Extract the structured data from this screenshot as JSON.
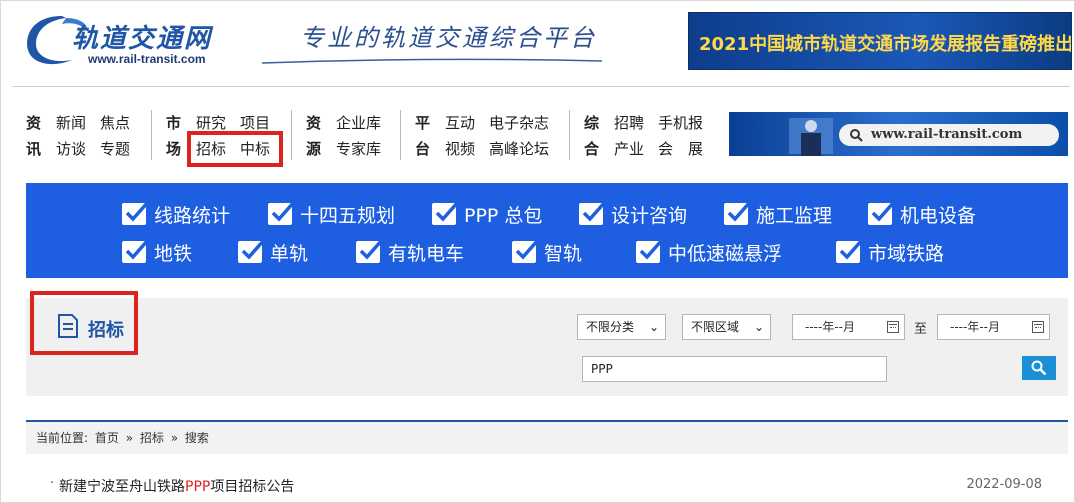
{
  "header": {
    "logo_cn": "轨道交通网",
    "logo_url": "www.rail-transit.com",
    "slogan": "专业的轨道交通综合平台",
    "banner_text": "2021中国城市轨道交通市场发展报告重磅推出"
  },
  "nav": {
    "groups": [
      {
        "head": [
          "资",
          "讯"
        ],
        "rows": [
          [
            "新闻",
            "焦点"
          ],
          [
            "访谈",
            "专题"
          ]
        ]
      },
      {
        "head": [
          "市",
          "场"
        ],
        "rows": [
          [
            "研究",
            "项目"
          ],
          [
            "招标",
            "中标"
          ]
        ]
      },
      {
        "head": [
          "资",
          "源"
        ],
        "rows": [
          [
            "企业库"
          ],
          [
            "专家库"
          ]
        ]
      },
      {
        "head": [
          "平",
          "台"
        ],
        "rows": [
          [
            "互动",
            "电子杂志"
          ],
          [
            "视频",
            "高峰论坛"
          ]
        ]
      },
      {
        "head": [
          "综",
          "合"
        ],
        "rows": [
          [
            "招聘",
            "手机报"
          ],
          [
            "产业",
            "会　展"
          ]
        ]
      }
    ],
    "banner_url": "www.rail-transit.com"
  },
  "categories": [
    "线路统计",
    "十四五规划",
    "PPP 总包",
    "设计咨询",
    "施工监理",
    "机电设备",
    "地铁",
    "单轨",
    "有轨电车",
    "智轨",
    "中低速磁悬浮",
    "市域铁路"
  ],
  "search": {
    "section_title": "招标",
    "category_select": "不限分类",
    "region_select": "不限区域",
    "date_from": "----年--月",
    "date_to": "----年--月",
    "to_label": "至",
    "keyword": "PPP"
  },
  "breadcrumb": {
    "prefix": "当前位置:",
    "items": [
      "首页",
      "»",
      "招标",
      "»",
      "搜索"
    ]
  },
  "results": [
    {
      "title_pre": "新建宁波至舟山铁路",
      "title_hl": "PPP",
      "title_post": "项目招标公告",
      "date": "2022-09-08"
    }
  ],
  "colors": {
    "brand_blue": "#1f56a6",
    "category_blue": "#1d5fe0",
    "highlight_red": "#d9251d",
    "search_button": "#1a8fd6"
  }
}
